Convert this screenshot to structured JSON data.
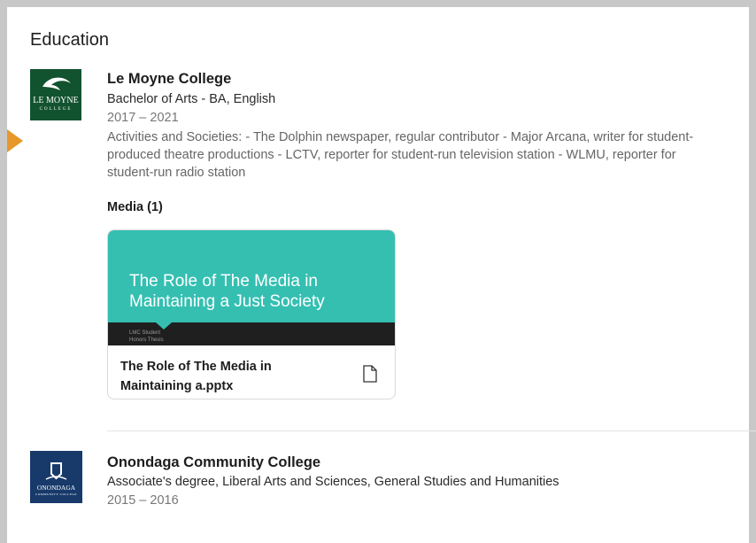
{
  "section": {
    "title": "Education"
  },
  "schools": [
    {
      "name": "Le Moyne College",
      "logo_text_main": "LE MOYNE",
      "logo_text_sub": "COLLEGE",
      "degree": "Bachelor of Arts - BA, English",
      "dates": "2017 – 2021",
      "activities": "Activities and Societies: - The Dolphin newspaper, regular contributor - Major Arcana, writer for student-produced theatre productions - LCTV, reporter for student-run television station - WLMU, reporter for student-run radio station",
      "media": {
        "heading": "Media (1)",
        "items": [
          {
            "slide_title": "The Role of The Media in Maintaining a Just Society",
            "slide_sub1": "LMC Student",
            "slide_sub2": "Honors Thesis",
            "title": "The Role of The Media in Maintaining a.pptx",
            "icon": "document-icon"
          }
        ]
      }
    },
    {
      "name": "Onondaga Community College",
      "logo_text_main": "ONONDAGA",
      "logo_text_sub": "COMMUNITY COLLEGE",
      "degree": "Associate's degree, Liberal Arts and Sciences, General Studies and Humanities",
      "dates": "2015 – 2016"
    }
  ],
  "colors": {
    "accent_pointer": "#e8972a",
    "le_moyne_green": "#12532f",
    "onondaga_blue": "#173a6a",
    "slide_teal": "#34bfb1"
  }
}
